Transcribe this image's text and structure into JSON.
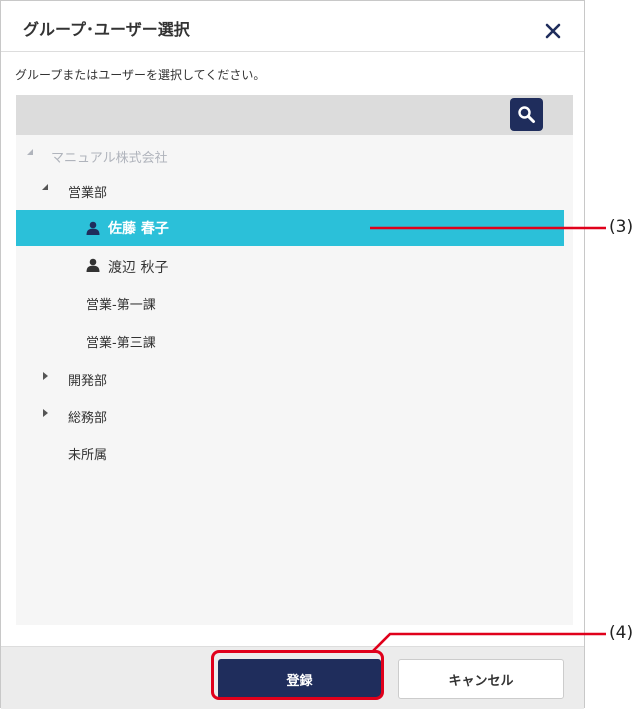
{
  "dialog": {
    "title": "グループ･ユーザー選択",
    "close_icon": "close-icon",
    "instruction": "グループまたはユーザーを選択してください。",
    "search_icon": "search-icon"
  },
  "tree": {
    "root": "マニュアル株式会社",
    "sales_dept": "営業部",
    "user_selected": "佐藤 春子",
    "user_2": "渡辺 秋子",
    "sales_team_1": "営業-第一課",
    "sales_team_3": "営業-第三課",
    "dev_dept": "開発部",
    "general_affairs_dept": "総務部",
    "unassigned": "未所属"
  },
  "footer": {
    "register_label": "登録",
    "cancel_label": "キャンセル"
  },
  "annotations": {
    "callout_3": "(3)",
    "callout_4": "(4)"
  },
  "colors": {
    "primary": "#1f2d5c",
    "selected_row": "#2bc0d9",
    "callout": "#e0001b"
  }
}
